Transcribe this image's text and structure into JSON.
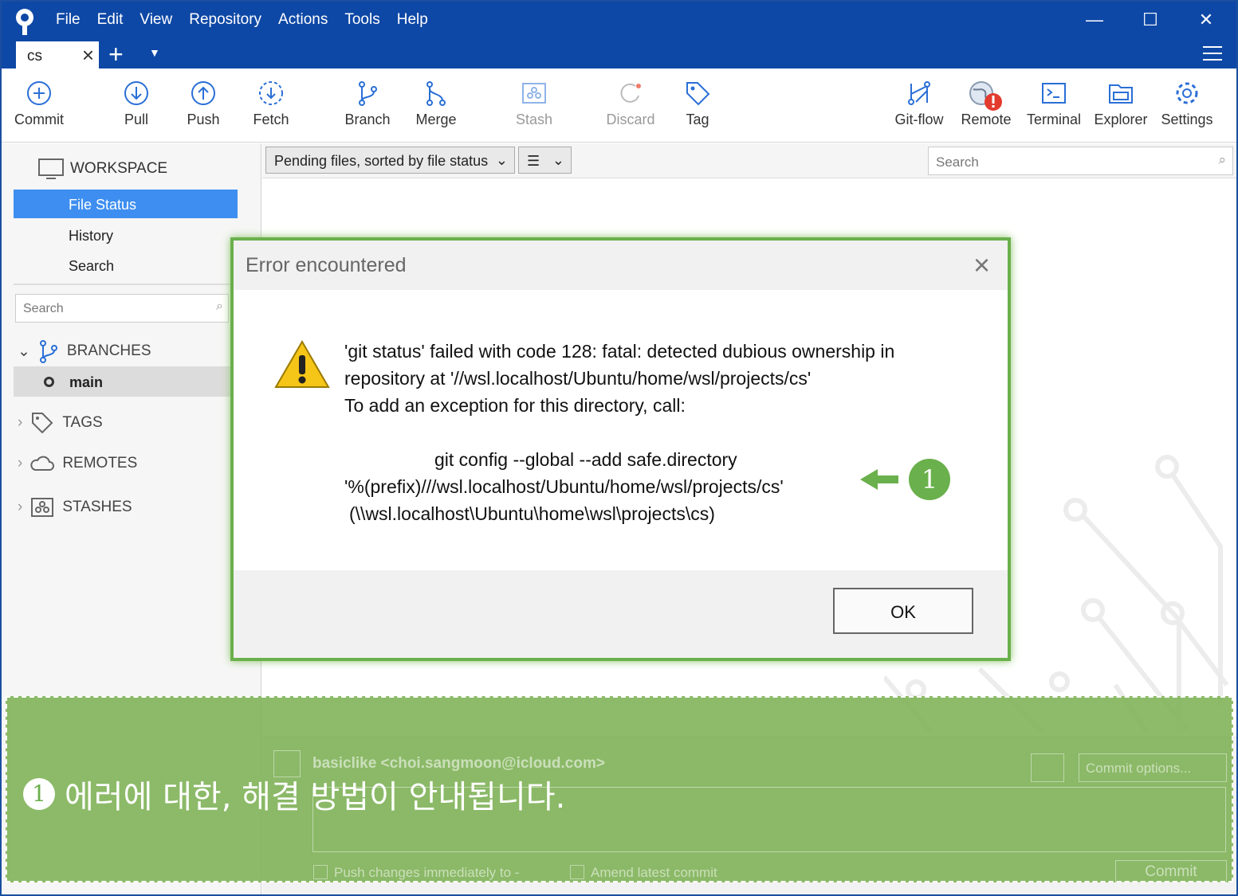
{
  "menu": [
    "File",
    "Edit",
    "View",
    "Repository",
    "Actions",
    "Tools",
    "Help"
  ],
  "tab": {
    "label": "cs"
  },
  "toolbar": {
    "commit": "Commit",
    "pull": "Pull",
    "push": "Push",
    "fetch": "Fetch",
    "branch": "Branch",
    "merge": "Merge",
    "stash": "Stash",
    "discard": "Discard",
    "tag": "Tag",
    "gitflow": "Git-flow",
    "remote": "Remote",
    "terminal": "Terminal",
    "explorer": "Explorer",
    "settings": "Settings"
  },
  "sidebar": {
    "workspace": "WORKSPACE",
    "file_status": "File Status",
    "history": "History",
    "search_item": "Search",
    "search_placeholder": "Search",
    "branches": "BRANCHES",
    "main_branch": "main",
    "tags": "TAGS",
    "remotes": "REMOTES",
    "stashes": "STASHES"
  },
  "content": {
    "sort_dropdown": "Pending files, sorted by file status",
    "search_placeholder": "Search"
  },
  "dialog": {
    "title": "Error encountered",
    "line1": "'git status' failed with code 128: fatal: detected dubious ownership in",
    "line2": "repository at '//wsl.localhost/Ubuntu/home/wsl/projects/cs'",
    "line3": "To add an exception for this directory, call:",
    "line4": "git config --global --add safe.directory",
    "line5": "'%(prefix)///wsl.localhost/Ubuntu/home/wsl/projects/cs'",
    "line6": "(\\\\wsl.localhost\\Ubuntu\\home\\wsl\\projects\\cs)",
    "ok": "OK",
    "callout_number": "1"
  },
  "commit_area": {
    "author": "basiclike <choi.sangmoon@icloud.com>",
    "commit_options": "Commit options...",
    "push_changes": "Push changes immediately to -",
    "amend": "Amend latest commit",
    "commit_btn": "Commit"
  },
  "annotation": {
    "number": "1",
    "text": "에러에 대한, 해결 방법이 안내됩니다."
  },
  "colors": {
    "titlebar": "#0e48a6",
    "selection": "#3d8ef0",
    "callout_green": "#6ab04c"
  }
}
